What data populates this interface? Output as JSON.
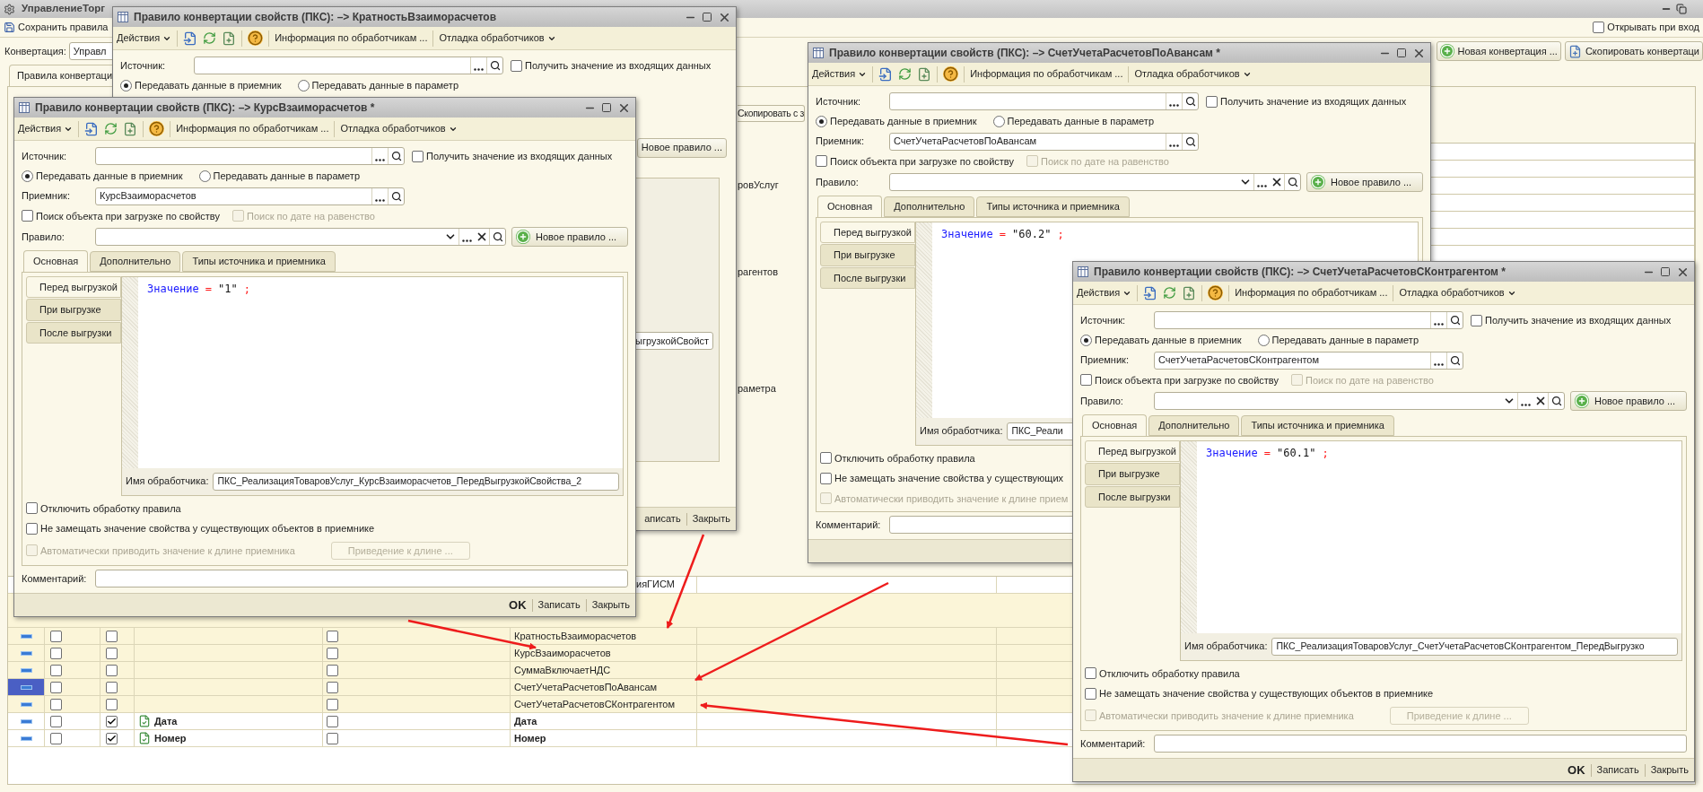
{
  "main_window": {
    "title": "УправлениеТорг",
    "toolbar": {
      "save_button": "Сохранить правила",
      "open_on_start": {
        "label": "Открывать при вход",
        "checked": false
      }
    },
    "conversion": {
      "label": "Конвертация:",
      "value": "Управл"
    },
    "buttons": [
      {
        "label": "Новая конвертация ...",
        "kind": "new"
      },
      {
        "label": "Скопировать конвертаци",
        "kind": "copy"
      }
    ],
    "tab": "Правила конвертаци",
    "fragments": [
      {
        "text": "Скопировать с з",
        "kind": "button"
      },
      {
        "text": "ровУслуг",
        "kind": "text"
      },
      {
        "text": "рагентов",
        "kind": "text"
      },
      {
        "text": "раметра",
        "kind": "text"
      }
    ],
    "table": {
      "rows": [
        {
          "kind": "fragment",
          "target": "ияГИСМ"
        },
        {
          "kind": "property",
          "selected": false,
          "check_1": false,
          "check_2": false,
          "check_3": false,
          "target": "КратностьВзаиморасчетов"
        },
        {
          "kind": "property",
          "selected": false,
          "check_1": false,
          "check_2": false,
          "check_3": false,
          "target": "КурсВзаиморасчетов"
        },
        {
          "kind": "property",
          "selected": false,
          "check_1": false,
          "check_2": false,
          "check_3": false,
          "target": "СуммаВключаетНДС"
        },
        {
          "kind": "property",
          "selected": true,
          "check_1": false,
          "check_2": false,
          "check_3": false,
          "target": "СчетУчетаРасчетовПоАвансам"
        },
        {
          "kind": "property",
          "selected": false,
          "check_1": false,
          "check_2": false,
          "check_3": false,
          "target": "СчетУчетаРасчетовСКонтрагентом"
        },
        {
          "kind": "attribute",
          "selected": false,
          "check_1": false,
          "check_2": true,
          "name": "Дата",
          "check_3": false,
          "target": "Дата"
        },
        {
          "kind": "attribute",
          "selected": false,
          "check_1": false,
          "check_2": true,
          "name": "Номер",
          "check_3": false,
          "target": "Номер"
        }
      ]
    }
  },
  "dialogs": [
    {
      "kind": "covered",
      "title": "Правило конвертации свойств (ПКС): –> КратностьВзаиморасчетов",
      "toolbar": {
        "actions": "Действия",
        "info": "Информация по обработчикам ...",
        "debug": "Отладка обработчиков"
      },
      "source": {
        "label": "Источник:",
        "incoming": {
          "label": "Получить значение из входящих данных",
          "checked": false
        }
      },
      "mode": [
        {
          "label": "Передавать данные в приемник",
          "selected": true
        },
        {
          "label": "Передавать данные в параметр",
          "selected": false
        }
      ],
      "new_rule_button": "Новое правило ...",
      "handler": {
        "value": "ыгрузкойСвойст"
      },
      "footer": [
        {
          "label": "аписать",
          "kind": "normal"
        },
        {
          "label": "Закрыть",
          "kind": "normal"
        }
      ]
    },
    {
      "kind": "full",
      "title": "Правило конвертации свойств (ПКС): –> КурсВзаиморасчетов *",
      "toolbar": {
        "actions": "Действия",
        "info": "Информация по обработчикам ...",
        "debug": "Отладка обработчиков"
      },
      "source": {
        "label": "Источник:",
        "incoming": {
          "label": "Получить значение из входящих данных",
          "checked": false
        }
      },
      "mode": [
        {
          "label": "Передавать данные в приемник",
          "selected": true
        },
        {
          "label": "Передавать данные в параметр",
          "selected": false
        }
      ],
      "receiver": {
        "label": "Приемник:",
        "value": "КурсВзаиморасчетов"
      },
      "search_by_property": {
        "label": "Поиск объекта при загрузке по свойству",
        "checked": false
      },
      "search_by_date": {
        "label": "Поиск по дате на равенство",
        "checked": false,
        "disabled": true
      },
      "rule": {
        "label": "Правило:"
      },
      "new_rule_button": "Новое правило ...",
      "tabs": [
        {
          "label": "Основная",
          "selected": true
        },
        {
          "label": "Дополнительно",
          "selected": false
        },
        {
          "label": "Типы источника и приемника",
          "selected": false
        }
      ],
      "events": [
        {
          "label": "Перед выгрузкой",
          "selected": true
        },
        {
          "label": "При выгрузке",
          "selected": false
        },
        {
          "label": "После выгрузки",
          "selected": false
        }
      ],
      "code": [
        {
          "kind": "identifier",
          "text": "Значение"
        },
        {
          "kind": "operator",
          "text": "="
        },
        {
          "kind": "string",
          "text": "\"1\""
        },
        {
          "kind": "operator",
          "text": ";"
        }
      ],
      "handler": {
        "label": "Имя обработчика:",
        "value": "ПКС_РеализацияТоваровУслуг_КурсВзаиморасчетов_ПередВыгрузкойСвойства_2"
      },
      "options": [
        {
          "label": "Отключить обработку правила",
          "checked": false,
          "disabled": false
        },
        {
          "label": "Не замещать значение свойства у существующих объектов в приемнике",
          "checked": false,
          "disabled": false
        },
        {
          "label": "Автоматически приводить значение к длине приемника",
          "checked": false,
          "disabled": true
        }
      ],
      "length_button": {
        "label": "Приведение к длине ...",
        "disabled": true
      },
      "comment": {
        "label": "Комментарий:"
      },
      "footer": [
        {
          "label": "OK",
          "kind": "default"
        },
        {
          "label": "Записать",
          "kind": "normal"
        },
        {
          "label": "Закрыть",
          "kind": "normal"
        }
      ]
    },
    {
      "kind": "full",
      "title": "Правило конвертации свойств (ПКС): –> СчетУчетаРасчетовПоАвансам *",
      "toolbar": {
        "actions": "Действия",
        "info": "Информация по обработчикам ...",
        "debug": "Отладка обработчиков"
      },
      "source": {
        "label": "Источник:",
        "incoming": {
          "label": "Получить значение из входящих данных",
          "checked": false
        }
      },
      "mode": [
        {
          "label": "Передавать данные в приемник",
          "selected": true
        },
        {
          "label": "Передавать данные в параметр",
          "selected": false
        }
      ],
      "receiver": {
        "label": "Приемник:",
        "value": "СчетУчетаРасчетовПоАвансам"
      },
      "search_by_property": {
        "label": "Поиск объекта при загрузке по свойству",
        "checked": false
      },
      "search_by_date": {
        "label": "Поиск по дате на равенство",
        "checked": false,
        "disabled": true
      },
      "rule": {
        "label": "Правило:"
      },
      "new_rule_button": "Новое правило ...",
      "tabs": [
        {
          "label": "Основная",
          "selected": true
        },
        {
          "label": "Дополнительно",
          "selected": false
        },
        {
          "label": "Типы источника и приемника",
          "selected": false
        }
      ],
      "events": [
        {
          "label": "Перед выгрузкой",
          "selected": true
        },
        {
          "label": "При выгрузке",
          "selected": false
        },
        {
          "label": "После выгрузки",
          "selected": false
        }
      ],
      "code": [
        {
          "kind": "identifier",
          "text": "Значение"
        },
        {
          "kind": "operator",
          "text": "="
        },
        {
          "kind": "string",
          "text": "\"60.2\""
        },
        {
          "kind": "operator",
          "text": ";"
        }
      ],
      "handler": {
        "label": "Имя обработчика:",
        "value": "ПКС_Реали"
      },
      "options": [
        {
          "label": "Отключить обработку правила",
          "checked": false,
          "disabled": false
        },
        {
          "label": "Не замещать значение свойства у существующих",
          "checked": false,
          "disabled": false
        },
        {
          "label": "Автоматически приводить значение к длине прием",
          "checked": false,
          "disabled": true
        }
      ],
      "comment": {
        "label": "Комментарий:"
      }
    },
    {
      "kind": "full",
      "title": "Правило конвертации свойств (ПКС): –> СчетУчетаРасчетовСКонтрагентом *",
      "toolbar": {
        "actions": "Действия",
        "info": "Информация по обработчикам ...",
        "debug": "Отладка обработчиков"
      },
      "source": {
        "label": "Источник:",
        "incoming": {
          "label": "Получить значение из входящих данных",
          "checked": false
        }
      },
      "mode": [
        {
          "label": "Передавать данные в приемник",
          "selected": true
        },
        {
          "label": "Передавать данные в параметр",
          "selected": false
        }
      ],
      "receiver": {
        "label": "Приемник:",
        "value": "СчетУчетаРасчетовСКонтрагентом"
      },
      "search_by_property": {
        "label": "Поиск объекта при загрузке по свойству",
        "checked": false
      },
      "search_by_date": {
        "label": "Поиск по дате на равенство",
        "checked": false,
        "disabled": true
      },
      "rule": {
        "label": "Правило:"
      },
      "new_rule_button": "Новое правило ...",
      "tabs": [
        {
          "label": "Основная",
          "selected": true
        },
        {
          "label": "Дополнительно",
          "selected": false
        },
        {
          "label": "Типы источника и приемника",
          "selected": false
        }
      ],
      "events": [
        {
          "label": "Перед выгрузкой",
          "selected": true
        },
        {
          "label": "При выгрузке",
          "selected": false
        },
        {
          "label": "После выгрузки",
          "selected": false
        }
      ],
      "code": [
        {
          "kind": "identifier",
          "text": "Значение"
        },
        {
          "kind": "operator",
          "text": "="
        },
        {
          "kind": "string",
          "text": "\"60.1\""
        },
        {
          "kind": "operator",
          "text": ";"
        }
      ],
      "handler": {
        "label": "Имя обработчика:",
        "value": "ПКС_РеализацияТоваровУслуг_СчетУчетаРасчетовСКонтрагентом_ПередВыгрузко"
      },
      "options": [
        {
          "label": "Отключить обработку правила",
          "checked": false,
          "disabled": false
        },
        {
          "label": "Не замещать значение свойства у существующих объектов в приемнике",
          "checked": false,
          "disabled": false
        },
        {
          "label": "Автоматически приводить значение к длине приемника",
          "checked": false,
          "disabled": true
        }
      ],
      "length_button": {
        "label": "Приведение к длине ...",
        "disabled": true
      },
      "comment": {
        "label": "Комментарий:"
      },
      "footer": [
        {
          "label": "OK",
          "kind": "default"
        },
        {
          "label": "Записать",
          "kind": "normal"
        },
        {
          "label": "Закрыть",
          "kind": "normal"
        }
      ]
    }
  ]
}
